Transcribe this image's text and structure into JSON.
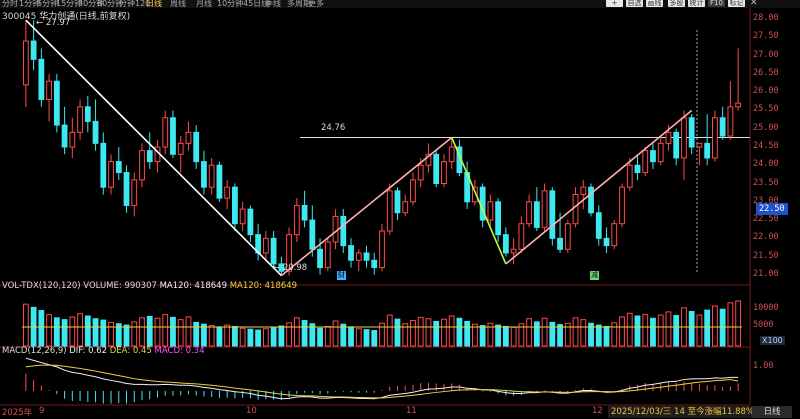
{
  "toolbar": {
    "periods": [
      "分时",
      "1分钟",
      "5分钟",
      "15分钟",
      "30分钟",
      "60分钟",
      "分钟120",
      "日线",
      "周线",
      "月线",
      "10分钟",
      "45日线",
      "季线",
      "多周期",
      "更多"
    ],
    "active_period": "日线",
    "tools": [
      "+",
      "自选",
      "画线",
      "多股",
      "统计",
      "F10",
      "标记"
    ],
    "window_controls": [
      "◁",
      "✕"
    ]
  },
  "stock": {
    "code": "300045",
    "name": "华力创通",
    "chart_mode": "(日线,前复权)"
  },
  "price_axis": [
    "28.00",
    "27.50",
    "27.00",
    "26.50",
    "26.00",
    "25.50",
    "25.00",
    "24.50",
    "24.00",
    "23.50",
    "23.00",
    "22.50",
    "22.00",
    "21.50",
    "21.00"
  ],
  "current_price": "22.50",
  "annotations": {
    "high": "27.97",
    "low": "20.98",
    "hline": "24.76"
  },
  "event_markers": [
    {
      "label": "财",
      "color": "#3fb0ff"
    },
    {
      "label": "减",
      "color": "#6fd86f"
    }
  ],
  "volume_panel": {
    "title": "VOL-TDX(120,120)",
    "volume_label": "VOLUME: 990307",
    "ma1_label": "MA120: 418649",
    "ma2_label": "MA120: 418649",
    "axis": [
      "10000",
      "5000"
    ],
    "unit": "X100"
  },
  "macd_panel": {
    "title": "MACD(12,26,9)",
    "dif": "DIF: 0.62",
    "dea": "DEA: 0.45",
    "macd": "MACD: 0.34",
    "axis": [
      "1.00"
    ]
  },
  "x_axis": [
    "2025年",
    "9",
    "10",
    "11",
    "12"
  ],
  "status": "2025/12/03/三 14 至今涨幅11.88%",
  "period_button": "日线",
  "colors": {
    "up": "#ff4a4a",
    "down": "#3ee8f0",
    "bg": "#000000",
    "zigzag_down": "#ffffff",
    "zigzag_up": "#ffb0b0",
    "zigzag_green": "#b6ff3a"
  },
  "chart_data": {
    "type": "candlestick",
    "title": "300045 华力创通(日线,前复权)",
    "ylim": [
      20.75,
      28.25
    ],
    "x_ticks": [
      "9",
      "10",
      "11",
      "12"
    ],
    "candles": [
      [
        26.2,
        27.97,
        25.6,
        27.4
      ],
      [
        27.4,
        27.97,
        26.6,
        26.9
      ],
      [
        26.9,
        27.2,
        25.6,
        25.8
      ],
      [
        25.8,
        26.5,
        25.2,
        26.3
      ],
      [
        26.3,
        26.5,
        24.9,
        25.1
      ],
      [
        25.1,
        25.6,
        24.3,
        24.5
      ],
      [
        24.5,
        25.3,
        24.2,
        24.9
      ],
      [
        24.9,
        25.8,
        24.7,
        25.6
      ],
      [
        25.6,
        25.9,
        24.9,
        25.2
      ],
      [
        25.2,
        25.8,
        24.4,
        24.6
      ],
      [
        24.6,
        24.9,
        23.2,
        23.4
      ],
      [
        23.4,
        24.3,
        23.2,
        24.1
      ],
      [
        24.1,
        24.5,
        23.6,
        23.8
      ],
      [
        23.8,
        24.0,
        22.7,
        22.9
      ],
      [
        22.9,
        23.8,
        22.6,
        23.6
      ],
      [
        23.6,
        24.6,
        23.4,
        24.4
      ],
      [
        24.4,
        24.9,
        23.9,
        24.1
      ],
      [
        24.1,
        24.7,
        23.8,
        24.5
      ],
      [
        24.5,
        25.5,
        24.3,
        25.3
      ],
      [
        25.3,
        25.5,
        24.2,
        24.3
      ],
      [
        24.3,
        24.8,
        23.8,
        24.6
      ],
      [
        24.6,
        25.2,
        24.4,
        24.9
      ],
      [
        24.9,
        25.1,
        23.9,
        24.1
      ],
      [
        24.1,
        24.4,
        23.2,
        23.4
      ],
      [
        23.4,
        24.2,
        23.2,
        24.0
      ],
      [
        24.0,
        24.1,
        23.0,
        23.1
      ],
      [
        23.1,
        23.6,
        22.8,
        23.4
      ],
      [
        23.4,
        23.5,
        22.2,
        22.4
      ],
      [
        22.4,
        23.0,
        22.2,
        22.8
      ],
      [
        22.8,
        22.9,
        21.9,
        22.1
      ],
      [
        22.1,
        22.4,
        21.4,
        21.6
      ],
      [
        21.6,
        22.2,
        21.4,
        22.0
      ],
      [
        22.0,
        22.2,
        21.2,
        21.3
      ],
      [
        21.3,
        21.5,
        20.98,
        21.1
      ],
      [
        21.1,
        22.3,
        20.98,
        22.1
      ],
      [
        22.1,
        23.1,
        21.9,
        22.9
      ],
      [
        22.9,
        23.3,
        22.3,
        22.5
      ],
      [
        22.5,
        22.9,
        21.5,
        21.7
      ],
      [
        21.7,
        22.0,
        21.0,
        21.2
      ],
      [
        21.2,
        22.0,
        21.1,
        21.9
      ],
      [
        21.9,
        22.8,
        21.7,
        22.6
      ],
      [
        22.6,
        22.8,
        21.6,
        21.8
      ],
      [
        21.8,
        22.0,
        21.2,
        21.4
      ],
      [
        21.4,
        21.7,
        21.1,
        21.6
      ],
      [
        21.6,
        21.8,
        21.2,
        21.4
      ],
      [
        21.4,
        21.6,
        21.0,
        21.2
      ],
      [
        21.2,
        22.4,
        21.1,
        22.2
      ],
      [
        22.2,
        23.5,
        22.1,
        23.3
      ],
      [
        23.3,
        23.4,
        22.5,
        22.7
      ],
      [
        22.7,
        23.2,
        22.6,
        23.0
      ],
      [
        23.0,
        23.8,
        22.9,
        23.6
      ],
      [
        23.6,
        24.2,
        23.4,
        24.0
      ],
      [
        24.0,
        24.6,
        23.8,
        24.3
      ],
      [
        24.3,
        24.4,
        23.4,
        23.5
      ],
      [
        23.5,
        24.3,
        23.4,
        24.1
      ],
      [
        24.1,
        24.76,
        23.9,
        24.5
      ],
      [
        24.5,
        24.7,
        23.7,
        23.8
      ],
      [
        23.8,
        24.1,
        22.8,
        23.0
      ],
      [
        23.0,
        23.6,
        22.9,
        23.4
      ],
      [
        23.4,
        23.5,
        22.3,
        22.5
      ],
      [
        22.5,
        23.2,
        22.3,
        23.0
      ],
      [
        23.0,
        23.1,
        21.9,
        22.1
      ],
      [
        22.1,
        22.3,
        21.5,
        21.6
      ],
      [
        21.6,
        22.0,
        21.3,
        21.7
      ],
      [
        21.7,
        22.6,
        21.6,
        22.4
      ],
      [
        22.4,
        23.2,
        22.3,
        23.0
      ],
      [
        23.0,
        23.4,
        22.2,
        22.3
      ],
      [
        22.3,
        23.5,
        22.2,
        23.3
      ],
      [
        23.3,
        23.4,
        21.8,
        22.0
      ],
      [
        22.0,
        22.7,
        21.6,
        21.7
      ],
      [
        21.7,
        22.5,
        21.6,
        22.4
      ],
      [
        22.4,
        23.4,
        22.3,
        23.2
      ],
      [
        23.2,
        23.6,
        22.8,
        23.4
      ],
      [
        23.4,
        23.5,
        22.6,
        22.7
      ],
      [
        22.7,
        22.9,
        21.8,
        22.0
      ],
      [
        22.0,
        22.3,
        21.6,
        21.8
      ],
      [
        21.8,
        22.5,
        21.7,
        22.4
      ],
      [
        22.4,
        23.5,
        22.3,
        23.4
      ],
      [
        23.4,
        24.2,
        23.3,
        24.0
      ],
      [
        24.0,
        24.3,
        23.6,
        23.8
      ],
      [
        23.8,
        24.5,
        23.7,
        24.4
      ],
      [
        24.4,
        24.6,
        23.9,
        24.1
      ],
      [
        24.1,
        24.8,
        24.0,
        24.6
      ],
      [
        24.6,
        25.1,
        24.4,
        24.9
      ],
      [
        24.9,
        25.0,
        24.0,
        24.2
      ],
      [
        24.2,
        25.5,
        23.6,
        25.3
      ],
      [
        25.3,
        25.4,
        24.3,
        24.5
      ],
      [
        24.5,
        24.6,
        24.0,
        24.6
      ],
      [
        24.6,
        25.4,
        24.0,
        24.2
      ],
      [
        24.2,
        25.5,
        24.1,
        25.3
      ],
      [
        25.3,
        25.6,
        24.7,
        24.8
      ],
      [
        24.8,
        26.3,
        24.7,
        25.6
      ],
      [
        25.6,
        27.2,
        25.5,
        25.7
      ]
    ],
    "volume": [
      9.2,
      8.5,
      7.8,
      6.9,
      6.2,
      5.8,
      6.4,
      7.1,
      6.6,
      6.0,
      5.7,
      5.2,
      4.9,
      4.6,
      5.3,
      6.2,
      6.5,
      6.1,
      6.9,
      6.3,
      5.8,
      6.4,
      5.2,
      4.8,
      4.5,
      4.2,
      4.6,
      4.3,
      3.9,
      3.7,
      3.5,
      3.8,
      4.1,
      4.4,
      5.1,
      6.2,
      5.6,
      4.9,
      3.9,
      4.3,
      5.5,
      4.8,
      4.2,
      3.8,
      3.6,
      3.4,
      5.0,
      6.8,
      5.9,
      4.9,
      5.6,
      6.3,
      6.0,
      5.4,
      5.9,
      6.6,
      6.1,
      5.4,
      4.8,
      4.5,
      5.0,
      4.6,
      4.3,
      4.1,
      4.9,
      6.0,
      5.3,
      6.1,
      5.2,
      4.7,
      5.0,
      6.2,
      5.8,
      5.0,
      4.6,
      4.3,
      5.1,
      6.4,
      7.2,
      6.6,
      6.9,
      6.1,
      6.8,
      7.5,
      6.7,
      8.4,
      7.6,
      6.8,
      7.9,
      8.8,
      8.1,
      9.5,
      9.9
    ],
    "volume_ma": 4.19,
    "volume_ylim": [
      0,
      11
    ],
    "macd": {
      "dif": [
        1.5,
        1.4,
        1.3,
        1.2,
        1.1,
        0.95,
        0.85,
        0.8,
        0.72,
        0.65,
        0.55,
        0.48,
        0.42,
        0.34,
        0.3,
        0.3,
        0.28,
        0.28,
        0.3,
        0.28,
        0.26,
        0.26,
        0.22,
        0.16,
        0.12,
        0.06,
        0.02,
        -0.04,
        -0.07,
        -0.12,
        -0.2,
        -0.24,
        -0.3,
        -0.36,
        -0.34,
        -0.28,
        -0.26,
        -0.28,
        -0.33,
        -0.33,
        -0.3,
        -0.3,
        -0.32,
        -0.34,
        -0.35,
        -0.36,
        -0.3,
        -0.2,
        -0.16,
        -0.12,
        -0.06,
        0.02,
        0.08,
        0.1,
        0.13,
        0.18,
        0.18,
        0.12,
        0.1,
        0.05,
        0.04,
        -0.02,
        -0.08,
        -0.12,
        -0.12,
        -0.08,
        -0.08,
        -0.04,
        -0.06,
        -0.1,
        -0.1,
        -0.04,
        0.02,
        0.02,
        -0.02,
        -0.06,
        -0.05,
        0.02,
        0.12,
        0.18,
        0.26,
        0.3,
        0.36,
        0.42,
        0.44,
        0.52,
        0.55,
        0.56,
        0.56,
        0.6,
        0.58,
        0.62,
        0.62
      ],
      "dea": [
        1.1,
        1.15,
        1.18,
        1.18,
        1.17,
        1.13,
        1.08,
        1.03,
        0.97,
        0.91,
        0.84,
        0.77,
        0.7,
        0.63,
        0.56,
        0.51,
        0.47,
        0.43,
        0.41,
        0.39,
        0.36,
        0.34,
        0.32,
        0.29,
        0.26,
        0.22,
        0.18,
        0.13,
        0.09,
        0.05,
        0.0,
        -0.05,
        -0.1,
        -0.15,
        -0.19,
        -0.21,
        -0.22,
        -0.23,
        -0.25,
        -0.27,
        -0.28,
        -0.28,
        -0.29,
        -0.3,
        -0.31,
        -0.32,
        -0.32,
        -0.3,
        -0.27,
        -0.24,
        -0.2,
        -0.16,
        -0.11,
        -0.07,
        -0.03,
        0.01,
        0.04,
        0.05,
        0.06,
        0.06,
        0.06,
        0.04,
        0.02,
        -0.01,
        -0.03,
        -0.04,
        -0.05,
        -0.05,
        -0.05,
        -0.06,
        -0.07,
        -0.06,
        -0.04,
        -0.03,
        -0.03,
        -0.03,
        -0.04,
        -0.03,
        0.0,
        0.04,
        0.08,
        0.13,
        0.17,
        0.22,
        0.26,
        0.31,
        0.36,
        0.4,
        0.43,
        0.47,
        0.49,
        0.52,
        0.45
      ]
    },
    "macd_ylim": [
      -0.6,
      1.6
    ]
  }
}
